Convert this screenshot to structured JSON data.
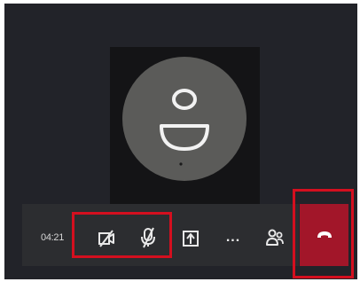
{
  "call": {
    "timer": "04:21",
    "avatar_icon": "person-icon",
    "controls": {
      "video_icon": "video-off-icon",
      "mic_icon": "mic-off-icon",
      "share_icon": "share-screen-icon",
      "more_label": "...",
      "participants_icon": "participants-icon",
      "hangup_icon": "hang-up-icon"
    }
  },
  "colors": {
    "background": "#222329",
    "toolbar": "#2c2d30",
    "avatar": "#5b5b59",
    "hangup": "#a21629",
    "highlight": "#d40f1f"
  }
}
